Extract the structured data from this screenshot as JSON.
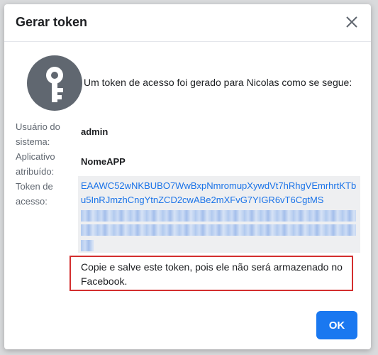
{
  "dialog": {
    "title": "Gerar token",
    "intro": "Um token de acesso foi gerado para Nicolas como se segue:",
    "labels": {
      "system_user": "Usuário do sistema:",
      "assigned_app": "Aplicativo atribuído:",
      "access_token": "Token de acesso:"
    },
    "values": {
      "system_user": "admin",
      "assigned_app": "NomeAPP",
      "token_visible": "EAAWC52wNKBUBO7WwBxpNmromupXywdVt7hRhgVEmrhrtKTbu5InRJmzhCngYtnZCD2cwABe2mXFvG7YIGR6vT6CgtMS"
    },
    "warning": "Copie e salve este token, pois ele não será armazenado no Facebook.",
    "ok_label": "OK"
  },
  "colors": {
    "accent": "#1a78f0",
    "token_link": "#1a73e8",
    "warning_border": "#d32f2f",
    "icon_bg": "#606770"
  },
  "icons": {
    "close": "close-icon",
    "key": "key-icon"
  }
}
